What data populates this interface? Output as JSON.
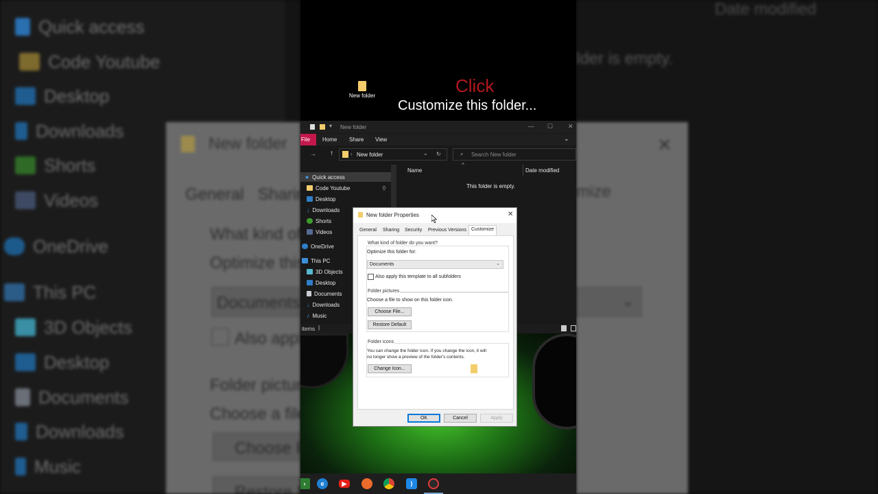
{
  "caption": {
    "click": "Click",
    "main": "Customize this folder..."
  },
  "desktop": {
    "folder_label": "New folder"
  },
  "explorer": {
    "title": "New folder",
    "ribbon_tabs": [
      "File",
      "Home",
      "Share",
      "View"
    ],
    "address": "New folder",
    "search_placeholder": "Search New folder",
    "columns": {
      "name": "Name",
      "date_modified": "Date modified"
    },
    "empty_text": "This folder is empty.",
    "status": "items",
    "nav": [
      {
        "label": "Quick access",
        "icon": "star-icon"
      },
      {
        "label": "Code Youtube",
        "icon": "folder-icon"
      },
      {
        "label": "Desktop",
        "icon": "desktop-icon"
      },
      {
        "label": "Downloads",
        "icon": "download-icon"
      },
      {
        "label": "Shorts",
        "icon": "tree-icon"
      },
      {
        "label": "Videos",
        "icon": "video-icon"
      },
      {
        "label": "OneDrive",
        "icon": "cloud-icon"
      },
      {
        "label": "This PC",
        "icon": "computer-icon"
      },
      {
        "label": "3D Objects",
        "icon": "cube-icon"
      },
      {
        "label": "Desktop",
        "icon": "desktop-icon"
      },
      {
        "label": "Documents",
        "icon": "document-icon"
      },
      {
        "label": "Downloads",
        "icon": "download-icon"
      },
      {
        "label": "Music",
        "icon": "music-icon"
      }
    ]
  },
  "dialog": {
    "title": "New folder Properties",
    "tabs": [
      "General",
      "Sharing",
      "Security",
      "Previous Versions",
      "Customize"
    ],
    "active_tab": "Customize",
    "q1": "What kind of folder do you want?",
    "optimize_label": "Optimize this folder for:",
    "optimize_value": "Documents",
    "apply_template": "Also apply this template to all subfolders",
    "folder_pictures": "Folder pictures",
    "choose_text": "Choose a file to show on this folder icon.",
    "choose_file": "Choose File...",
    "restore_default": "Restore Default",
    "folder_icons": "Folder icons",
    "icons_text_1": "You can change the folder icon. If you change the icon, it will",
    "icons_text_2": "no longer show a preview of the folder's contents.",
    "change_icon": "Change Icon...",
    "ok": "OK",
    "cancel": "Cancel",
    "apply": "Apply"
  },
  "background": {
    "left_nav": [
      "Quick access",
      "Code Youtube",
      "Desktop",
      "Downloads",
      "Shorts",
      "Videos",
      "OneDrive",
      "This PC",
      "3D Objects",
      "Desktop",
      "Documents",
      "Downloads",
      "Music"
    ],
    "left_dialog_title": "New folder",
    "left_tabs": [
      "General",
      "Sharin"
    ],
    "left_q": "What kind of",
    "left_opt": "Optimize this",
    "left_dd": "Documents",
    "left_apply": "Also apply",
    "left_pics": "Folder picture",
    "left_choose": "Choose a file",
    "left_btn1": "Choose F",
    "left_btn2": "Restore D",
    "right_date": "Date modified",
    "right_empty": "lder is empty.",
    "right_tab": "mize"
  },
  "taskbar": [
    "start-arrow-icon",
    "edge-icon",
    "youtube-icon",
    "firefox-icon",
    "chrome-icon",
    "vscode-icon",
    "recorder-icon"
  ]
}
